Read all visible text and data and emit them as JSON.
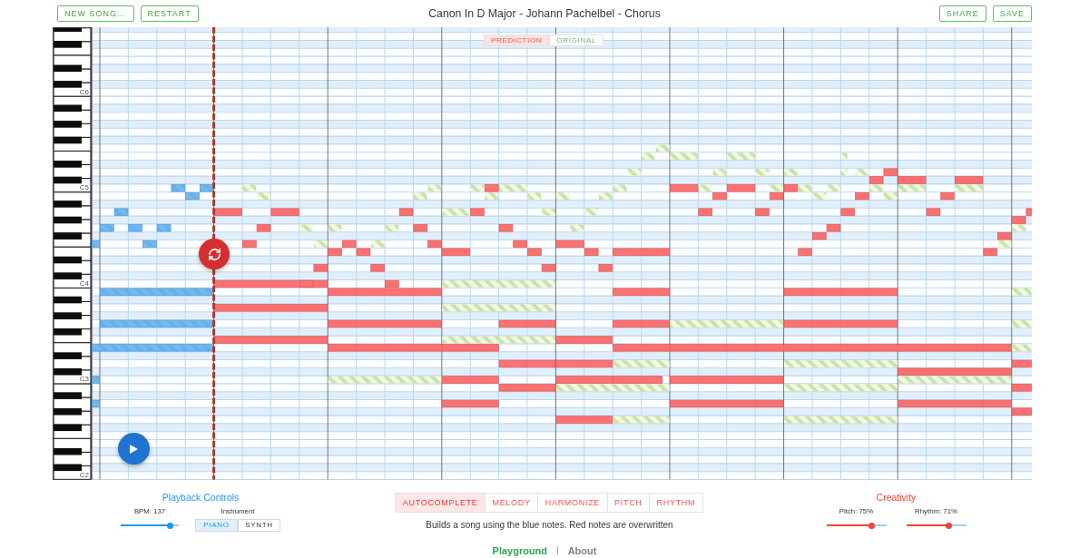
{
  "header": {
    "left_buttons": [
      "NEW SONG...",
      "RESTART"
    ],
    "title": "Canon In D Major - Johann Pachelbel - Chorus",
    "right_buttons": [
      "SHARE",
      "SAVE"
    ]
  },
  "view_toggle": [
    {
      "label": "PREDICTION",
      "kind": "prediction",
      "selected": true
    },
    {
      "label": "ORIGINAL",
      "kind": "original",
      "selected": false
    }
  ],
  "keyboard": {
    "octave_labels": [
      "C6",
      "C5",
      "C4",
      "C3",
      "C2"
    ]
  },
  "playback_controls": {
    "title": "Playback Controls",
    "bpm": {
      "label": "BPM: 137",
      "level": 0.85
    },
    "instrument": {
      "label": "Instrument",
      "options": [
        {
          "label": "PIANO",
          "selected": true
        },
        {
          "label": "SYNTH",
          "selected": false
        }
      ]
    }
  },
  "modes": {
    "tabs": [
      {
        "label": "AUTOCOMPLETE",
        "selected": true
      },
      {
        "label": "MELODY",
        "selected": false
      },
      {
        "label": "HARMONIZE",
        "selected": false
      },
      {
        "label": "PITCH",
        "selected": false
      },
      {
        "label": "RHYTHM",
        "selected": false
      }
    ],
    "description": "Builds a song using the blue notes. Red notes are overwritten"
  },
  "creativity": {
    "title": "Creativity",
    "sliders": [
      {
        "label": "Pitch: 75%",
        "level": 0.75
      },
      {
        "label": "Rhythm: 71%",
        "level": 0.71
      }
    ]
  },
  "footer": {
    "links": [
      {
        "label": "Playground",
        "selected": true
      },
      {
        "label": "About",
        "selected": false
      }
    ],
    "separator": "|"
  }
}
